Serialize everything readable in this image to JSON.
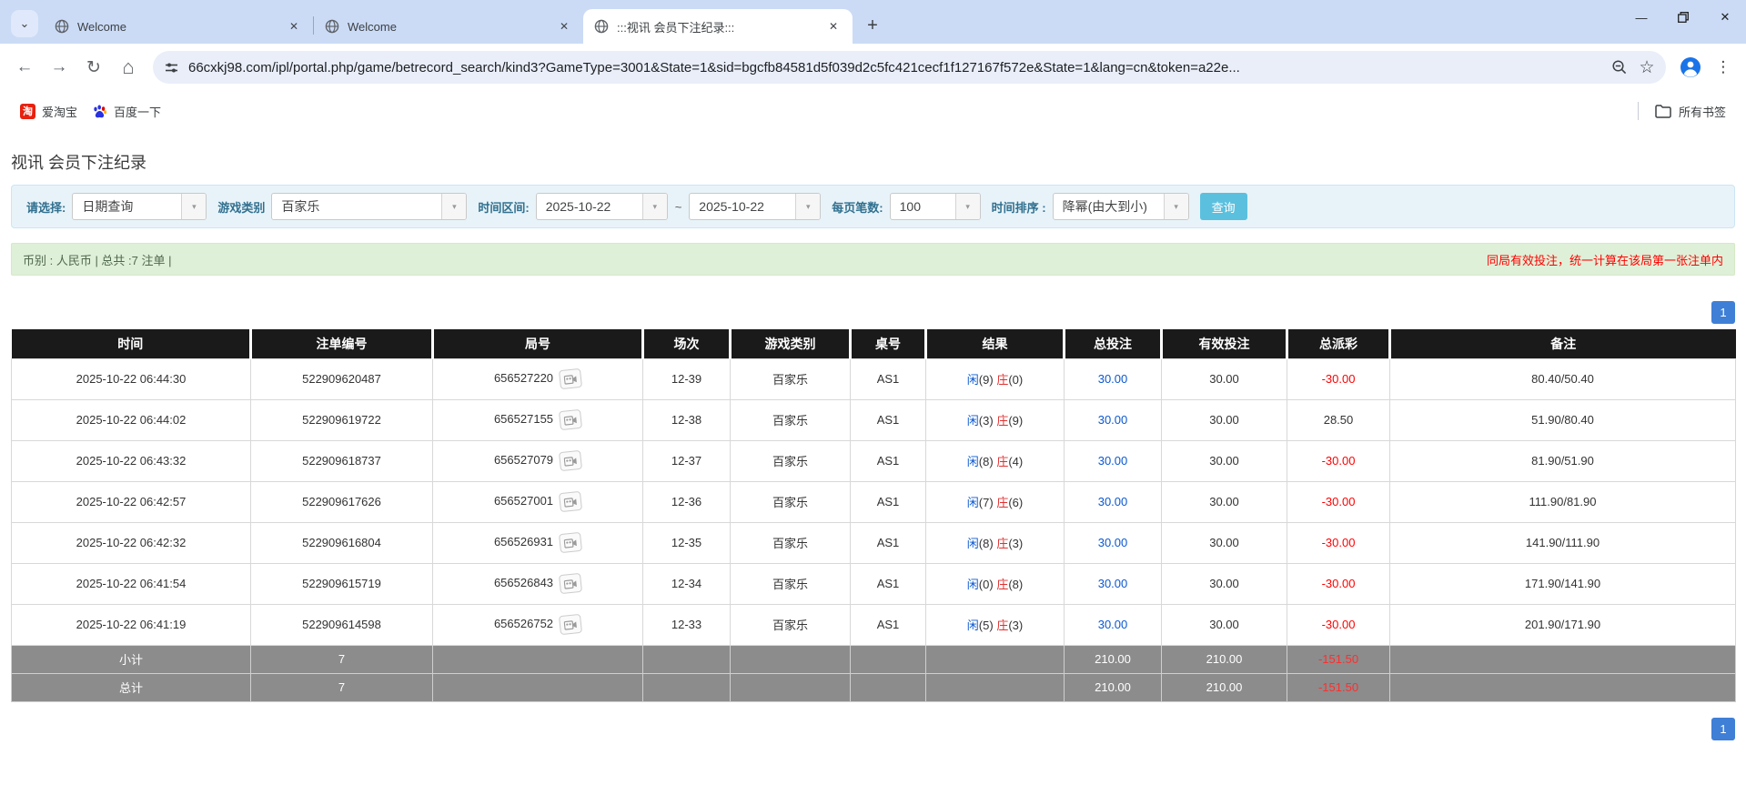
{
  "icons": {
    "tab_search": "⌄",
    "close": "✕",
    "new_tab": "+",
    "minimize": "—",
    "back": "←",
    "forward": "→",
    "reload": "↻",
    "home": "⌂",
    "star": "☆",
    "menu": "⋮",
    "dropdown": "▾"
  },
  "colors": {
    "tabstrip_bg": "#cbdbf6",
    "query_button": "#5bc0de",
    "pagination_blue": "#3f7fd6",
    "link_blue": "#0a58d0",
    "player_blue": "#0a58d0",
    "banker_red": "#e03030",
    "negative_red": "#ff0000",
    "header_black": "#1a1a1a",
    "summary_gray": "#8c8c8c",
    "info_green_bg": "#dff0d8"
  },
  "browser": {
    "tabs": [
      {
        "title": "Welcome"
      },
      {
        "title": "Welcome"
      },
      {
        "title": ":::视讯 会员下注纪录:::"
      }
    ],
    "url": "66cxkj98.com/ipl/portal.php/game/betrecord_search/kind3?GameType=3001&State=1&sid=bgcfb84581d5f039d2c5fc421cecf1f127167f572e&State=1&lang=cn&token=a22e...",
    "bookmarks": [
      {
        "label": "爱淘宝",
        "icon_text": "淘"
      },
      {
        "label": "百度一下"
      }
    ],
    "all_bookmarks_label": "所有书签"
  },
  "page": {
    "title": "视讯 会员下注纪录",
    "filters": {
      "select_label": "请选择:",
      "select_value": "日期查询",
      "game_type_label": "游戏类别",
      "game_type_value": "百家乐",
      "date_range_label": "时间区间:",
      "date_from": "2025-10-22",
      "tilde": "~",
      "date_to": "2025-10-22",
      "page_size_label": "每页笔数:",
      "page_size_value": "100",
      "sort_label": "时间排序 :",
      "sort_value": "降幂(由大到小)",
      "search_button": "查询"
    },
    "info_bar": {
      "left": "币别 : 人民币 | 总共 :7 注单 |",
      "right": "同局有效投注，统一计算在该局第一张注单内"
    },
    "pagination": {
      "page": "1"
    },
    "table": {
      "headers": [
        "时间",
        "注单编号",
        "局号",
        "场次",
        "游戏类别",
        "桌号",
        "结果",
        "总投注",
        "有效投注",
        "总派彩",
        "备注"
      ],
      "rows": [
        {
          "time": "2025-10-22 06:44:30",
          "bet_id": "522909620487",
          "round_id": "656527220",
          "session": "12-39",
          "game": "百家乐",
          "table_no": "AS1",
          "player": "闲",
          "player_score": "(9)",
          "banker": "庄",
          "banker_score": "(0)",
          "total_bet": "30.00",
          "valid_bet": "30.00",
          "payout": "-30.00",
          "note": "80.40/50.40"
        },
        {
          "time": "2025-10-22 06:44:02",
          "bet_id": "522909619722",
          "round_id": "656527155",
          "session": "12-38",
          "game": "百家乐",
          "table_no": "AS1",
          "player": "闲",
          "player_score": "(3)",
          "banker": "庄",
          "banker_score": "(9)",
          "total_bet": "30.00",
          "valid_bet": "30.00",
          "payout": "28.50",
          "note": "51.90/80.40"
        },
        {
          "time": "2025-10-22 06:43:32",
          "bet_id": "522909618737",
          "round_id": "656527079",
          "session": "12-37",
          "game": "百家乐",
          "table_no": "AS1",
          "player": "闲",
          "player_score": "(8)",
          "banker": "庄",
          "banker_score": "(4)",
          "total_bet": "30.00",
          "valid_bet": "30.00",
          "payout": "-30.00",
          "note": "81.90/51.90"
        },
        {
          "time": "2025-10-22 06:42:57",
          "bet_id": "522909617626",
          "round_id": "656527001",
          "session": "12-36",
          "game": "百家乐",
          "table_no": "AS1",
          "player": "闲",
          "player_score": "(7)",
          "banker": "庄",
          "banker_score": "(6)",
          "total_bet": "30.00",
          "valid_bet": "30.00",
          "payout": "-30.00",
          "note": "111.90/81.90"
        },
        {
          "time": "2025-10-22 06:42:32",
          "bet_id": "522909616804",
          "round_id": "656526931",
          "session": "12-35",
          "game": "百家乐",
          "table_no": "AS1",
          "player": "闲",
          "player_score": "(8)",
          "banker": "庄",
          "banker_score": "(3)",
          "total_bet": "30.00",
          "valid_bet": "30.00",
          "payout": "-30.00",
          "note": "141.90/111.90"
        },
        {
          "time": "2025-10-22 06:41:54",
          "bet_id": "522909615719",
          "round_id": "656526843",
          "session": "12-34",
          "game": "百家乐",
          "table_no": "AS1",
          "player": "闲",
          "player_score": "(0)",
          "banker": "庄",
          "banker_score": "(8)",
          "total_bet": "30.00",
          "valid_bet": "30.00",
          "payout": "-30.00",
          "note": "171.90/141.90"
        },
        {
          "time": "2025-10-22 06:41:19",
          "bet_id": "522909614598",
          "round_id": "656526752",
          "session": "12-33",
          "game": "百家乐",
          "table_no": "AS1",
          "player": "闲",
          "player_score": "(5)",
          "banker": "庄",
          "banker_score": "(3)",
          "total_bet": "30.00",
          "valid_bet": "30.00",
          "payout": "-30.00",
          "note": "201.90/171.90"
        }
      ],
      "subtotal": {
        "label": "小计",
        "count": "7",
        "total_bet": "210.00",
        "valid_bet": "210.00",
        "payout": "-151.50"
      },
      "total": {
        "label": "总计",
        "count": "7",
        "total_bet": "210.00",
        "valid_bet": "210.00",
        "payout": "-151.50"
      }
    }
  }
}
